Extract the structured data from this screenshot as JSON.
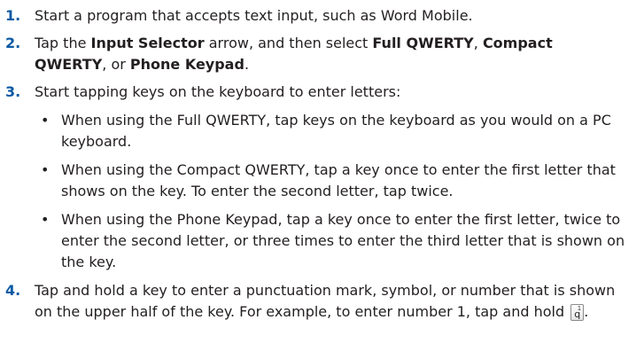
{
  "steps": [
    {
      "num": "1.",
      "parts": [
        "Start a program that accepts text input, such as Word Mobile."
      ]
    },
    {
      "num": "2.",
      "parts": [
        "Tap the ",
        "Input Selector",
        " arrow, and then select ",
        "Full QWERTY",
        ", ",
        "Compact QWERTY",
        ", or ",
        "Phone Keypad",
        "."
      ]
    },
    {
      "num": "3.",
      "parts": [
        "Start tapping keys on the keyboard to enter letters:"
      ],
      "bullets": [
        "When using the Full QWERTY, tap keys on the keyboard as you would on a PC keyboard.",
        "When using the Compact QWERTY, tap a key once to enter the first letter that shows on the key. To enter the second letter, tap twice.",
        "When using the Phone Keypad, tap a key once to enter the first letter, twice to enter the second letter, or three times to enter the third letter that is shown on the key."
      ]
    },
    {
      "num": "4.",
      "parts": [
        "Tap and hold a key to enter a punctuation mark, symbol, or number that is shown on the upper half of the key. For example, to enter number 1, tap and hold "
      ],
      "key_icon": {
        "top": "1",
        "main": "q"
      },
      "suffix": "."
    }
  ],
  "bullet_symbol": "•",
  "colors": {
    "step_number": "#0b5aa4",
    "text": "#231f20"
  }
}
